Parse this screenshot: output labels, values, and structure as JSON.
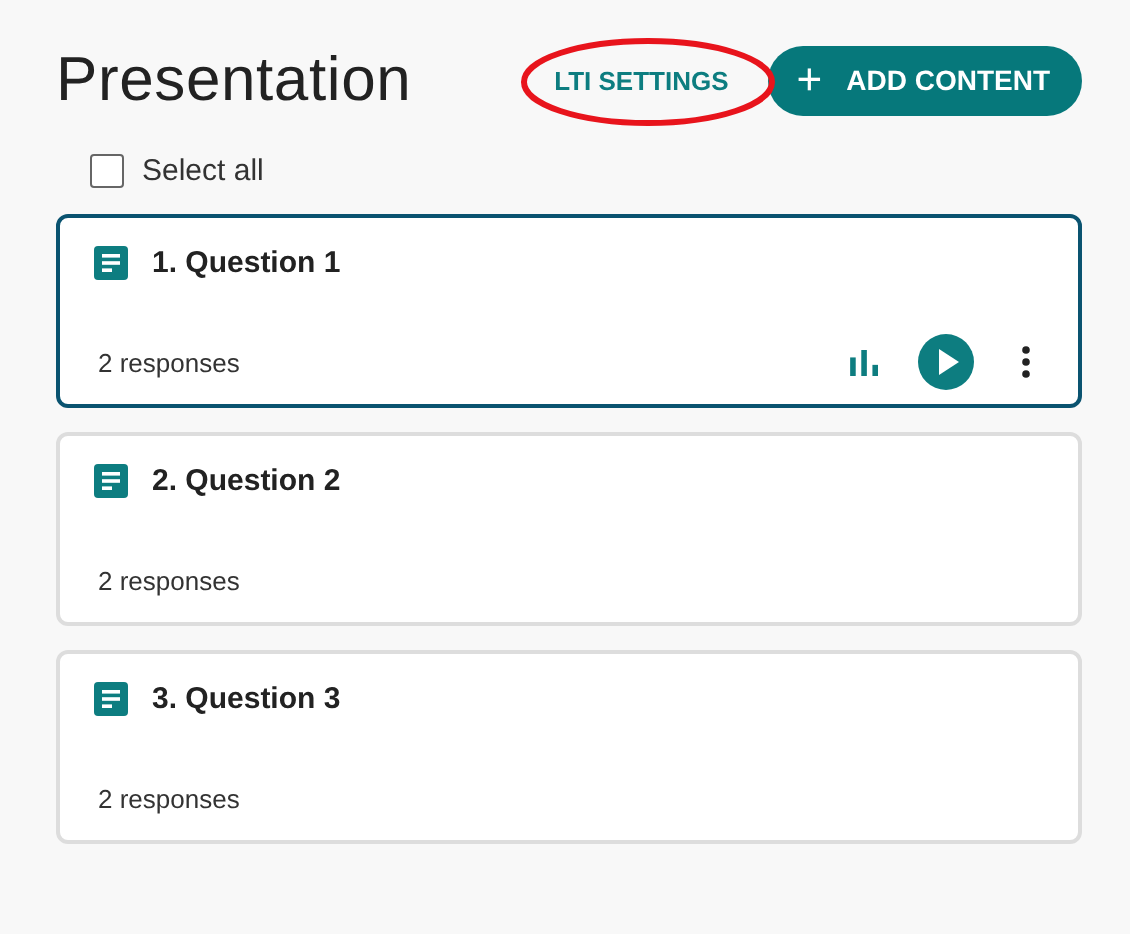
{
  "title": "Presentation",
  "lti_button": {
    "label": "LTI SETTINGS",
    "circled": true
  },
  "add_button": {
    "icon": "+",
    "label": "ADD CONTENT"
  },
  "select_all": {
    "label": "Select all",
    "checked": false
  },
  "items": [
    {
      "title": "1. Question 1",
      "responses": "2 responses",
      "selected": true
    },
    {
      "title": "2. Question 2",
      "responses": "2 responses",
      "selected": false
    },
    {
      "title": "3. Question 3",
      "responses": "2 responses",
      "selected": false
    }
  ]
}
